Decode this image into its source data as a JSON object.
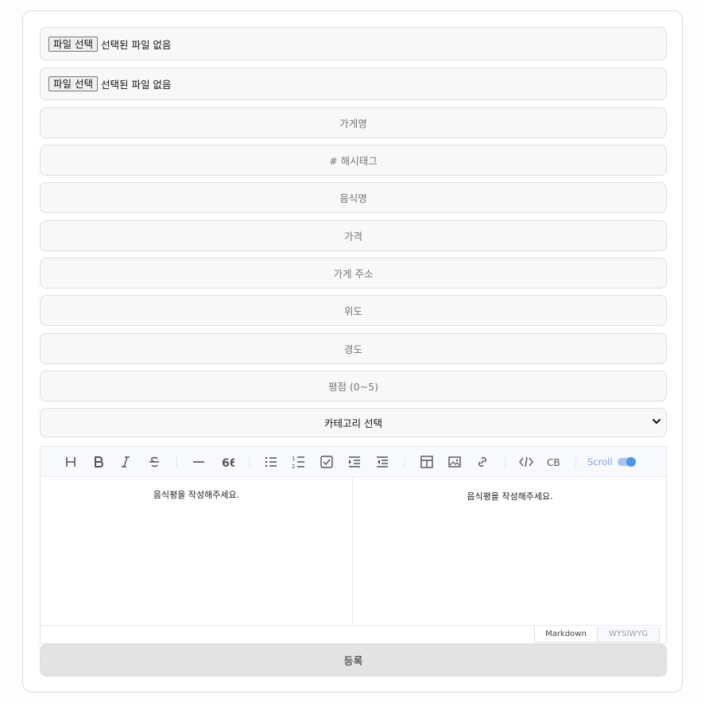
{
  "file_inputs": [
    {
      "button_label": "파일 선택",
      "status": "선택된 파일 없음"
    },
    {
      "button_label": "파일 선택",
      "status": "선택된 파일 없음"
    }
  ],
  "fields": {
    "store_name": "가게명",
    "hashtag": "# 해시태그",
    "food_name": "음식명",
    "price": "가격",
    "address": "가게 주소",
    "latitude": "위도",
    "longitude": "경도",
    "rating": "평점 (0~5)"
  },
  "category_select": {
    "selected": "카테고리 선택"
  },
  "editor": {
    "toolbar": {
      "icons": [
        "heading-icon",
        "bold-icon",
        "italic-icon",
        "strike-icon",
        "hr-icon",
        "quote-icon",
        "bullet-list-icon",
        "ordered-list-icon",
        "task-list-icon",
        "indent-icon",
        "outdent-icon",
        "table-icon",
        "image-icon",
        "link-icon",
        "code-icon",
        "codeblock-icon"
      ],
      "scroll_label": "Scroll",
      "scroll_sync": true
    },
    "markdown_placeholder": "음식평을 작성해주세요.",
    "preview_placeholder": "음식평을 작성해주세요.",
    "mode_tabs": [
      "Markdown",
      "WYSIWYG"
    ],
    "active_mode": "Markdown"
  },
  "submit_label": "등록",
  "colors": {
    "field_bg": "#f8f8f8",
    "toolbar_bg": "#f7f9fc",
    "accent": "#4b96e6",
    "submit_bg": "#e3e3e3"
  }
}
